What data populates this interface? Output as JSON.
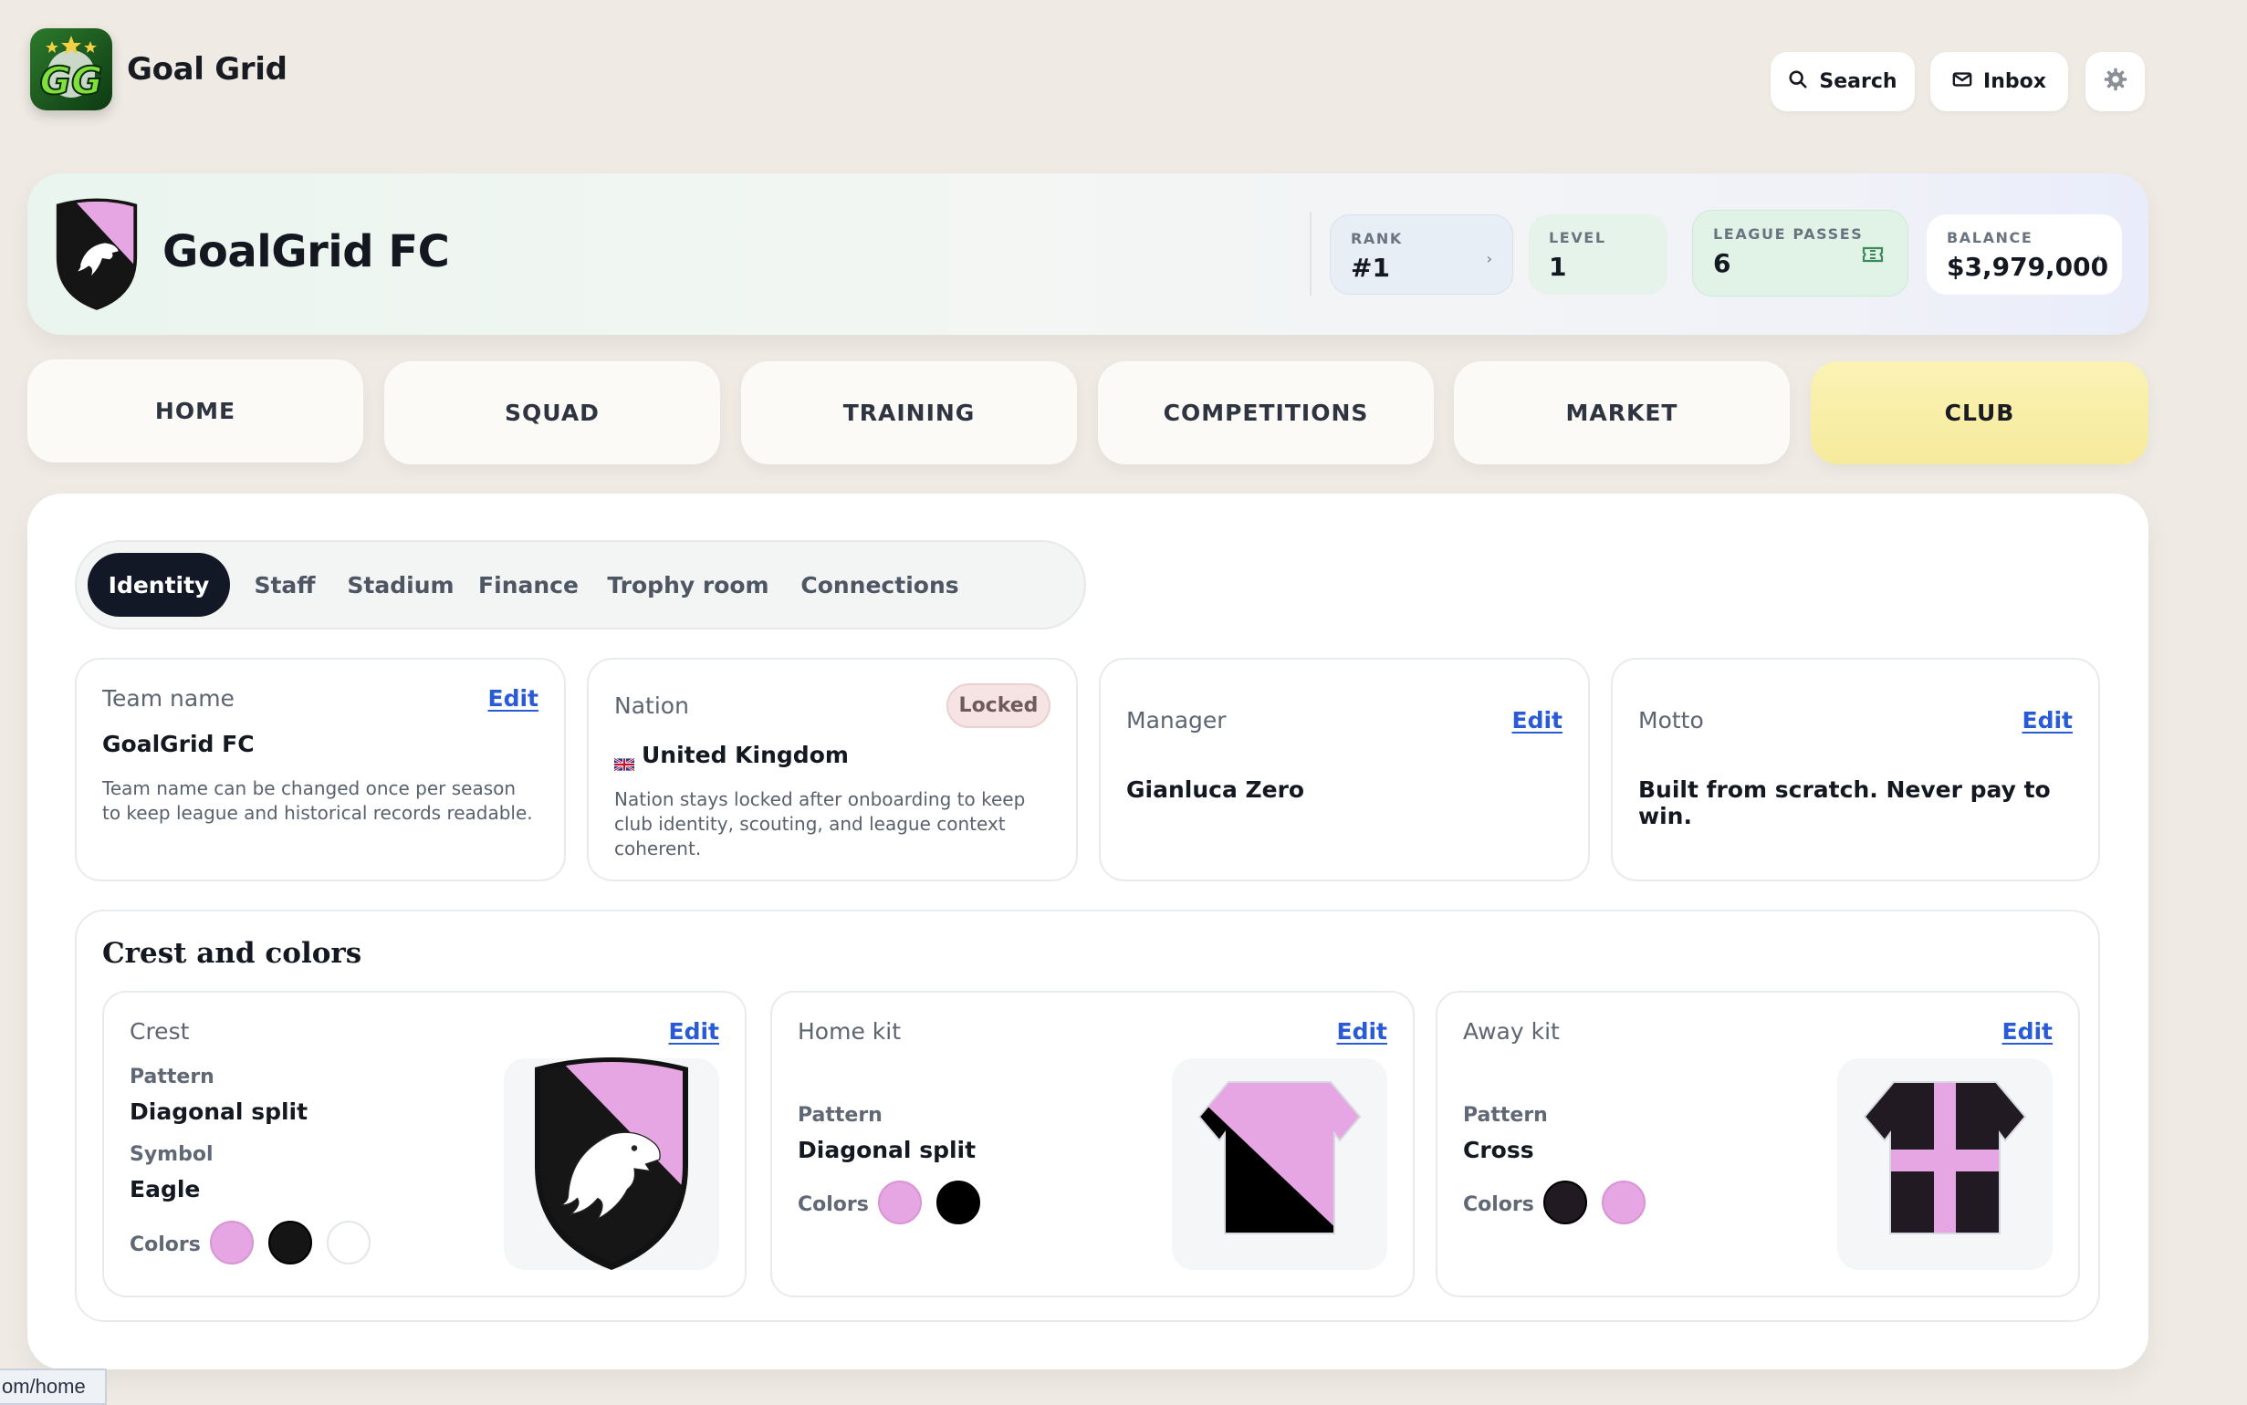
{
  "app": {
    "title": "Goal Grid",
    "logo_text": "GG"
  },
  "topbar": {
    "search_label": "Search",
    "inbox_label": "Inbox"
  },
  "club": {
    "name": "GoalGrid FC",
    "stats": {
      "rank_label": "RANK",
      "rank_value": "#1",
      "level_label": "LEVEL",
      "level_value": "1",
      "passes_label": "LEAGUE PASSES",
      "passes_value": "6",
      "balance_label": "BALANCE",
      "balance_value": "$3,979,000"
    }
  },
  "nav": {
    "tabs": [
      {
        "label": "HOME"
      },
      {
        "label": "SQUAD"
      },
      {
        "label": "TRAINING"
      },
      {
        "label": "COMPETITIONS"
      },
      {
        "label": "MARKET"
      },
      {
        "label": "CLUB"
      }
    ],
    "active": "CLUB"
  },
  "subtabs": {
    "items": [
      {
        "label": "Identity"
      },
      {
        "label": "Staff"
      },
      {
        "label": "Stadium"
      },
      {
        "label": "Finance"
      },
      {
        "label": "Trophy room"
      },
      {
        "label": "Connections"
      }
    ],
    "active": "Identity"
  },
  "identity": {
    "team_name": {
      "label": "Team name",
      "edit": "Edit",
      "value": "GoalGrid FC",
      "desc": "Team name can be changed once per season to keep league and historical records readable."
    },
    "nation": {
      "label": "Nation",
      "badge": "Locked",
      "value": "United Kingdom",
      "desc": "Nation stays locked after onboarding to keep club identity, scouting, and league context coherent."
    },
    "manager": {
      "label": "Manager",
      "edit": "Edit",
      "value": "Gianluca Zero"
    },
    "motto": {
      "label": "Motto",
      "edit": "Edit",
      "value": "Built from scratch. Never pay to win."
    }
  },
  "crest_section": {
    "title": "Crest and colors",
    "crest": {
      "label": "Crest",
      "edit": "Edit",
      "pattern_label": "Pattern",
      "pattern_value": "Diagonal split",
      "symbol_label": "Symbol",
      "symbol_value": "Eagle",
      "colors_label": "Colors",
      "colors": [
        "#e6a6e3",
        "#151515",
        "#ffffff"
      ]
    },
    "home_kit": {
      "label": "Home kit",
      "edit": "Edit",
      "pattern_label": "Pattern",
      "pattern_value": "Diagonal split",
      "colors_label": "Colors",
      "colors": [
        "#e6a6e3",
        "#000000"
      ]
    },
    "away_kit": {
      "label": "Away kit",
      "edit": "Edit",
      "pattern_label": "Pattern",
      "pattern_value": "Cross",
      "colors_label": "Colors",
      "colors": [
        "#221a22",
        "#e6a6e3"
      ]
    }
  },
  "status_url": "om/home",
  "colors": {
    "accent_link": "#2a5bd7",
    "active_nav": "#f6ea9c",
    "dark_pill": "#121826"
  }
}
